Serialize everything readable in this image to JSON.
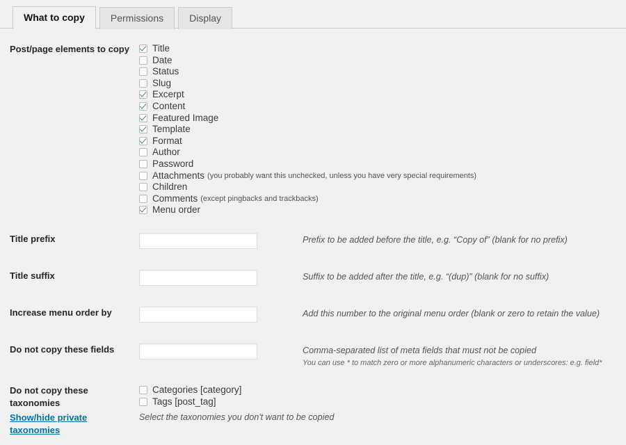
{
  "tabs": [
    {
      "label": "What to copy",
      "active": true
    },
    {
      "label": "Permissions",
      "active": false
    },
    {
      "label": "Display",
      "active": false
    }
  ],
  "elements_section": {
    "label": "Post/page elements to copy",
    "items": [
      {
        "label": "Title",
        "checked": true,
        "note": ""
      },
      {
        "label": "Date",
        "checked": false,
        "note": ""
      },
      {
        "label": "Status",
        "checked": false,
        "note": ""
      },
      {
        "label": "Slug",
        "checked": false,
        "note": ""
      },
      {
        "label": "Excerpt",
        "checked": true,
        "note": ""
      },
      {
        "label": "Content",
        "checked": true,
        "note": ""
      },
      {
        "label": "Featured Image",
        "checked": true,
        "note": ""
      },
      {
        "label": "Template",
        "checked": true,
        "note": ""
      },
      {
        "label": "Format",
        "checked": true,
        "note": ""
      },
      {
        "label": "Author",
        "checked": false,
        "note": ""
      },
      {
        "label": "Password",
        "checked": false,
        "note": ""
      },
      {
        "label": "Attachments",
        "checked": false,
        "note": "(you probably want this unchecked, unless you have very special requirements)"
      },
      {
        "label": "Children",
        "checked": false,
        "note": ""
      },
      {
        "label": "Comments",
        "checked": false,
        "note": "(except pingbacks and trackbacks)"
      },
      {
        "label": "Menu order",
        "checked": true,
        "note": ""
      }
    ]
  },
  "fields": [
    {
      "label": "Title prefix",
      "value": "",
      "placeholder": "",
      "desc": "Prefix to be added before the title, e.g. “Copy of” (blank for no prefix)",
      "desc2": ""
    },
    {
      "label": "Title suffix",
      "value": "",
      "placeholder": "",
      "desc": "Suffix to be added after the title, e.g. “(dup)” (blank for no suffix)",
      "desc2": ""
    },
    {
      "label": "Increase menu order by",
      "value": "",
      "placeholder": "",
      "desc": "Add this number to the original menu order (blank or zero to retain the value)",
      "desc2": ""
    },
    {
      "label": "Do not copy these fields",
      "value": "",
      "placeholder": "",
      "desc": "Comma-separated list of meta fields that must not be copied",
      "desc2": "You can use * to match zero or more alphanumeric characters or underscores: e.g. field*"
    }
  ],
  "taxonomies_section": {
    "label_line1": "Do not copy these",
    "label_line2": "taxonomies",
    "toggle_link": "Show/hide private taxonomies",
    "items": [
      {
        "label": "Categories [category]",
        "checked": false
      },
      {
        "label": "Tags [post_tag]",
        "checked": false
      }
    ],
    "desc": "Select the taxonomies you don't want to be copied"
  },
  "colors": {
    "page_background": "#f1f1f1",
    "tab_inactive_background": "#e5e5e5",
    "border": "#cccccc",
    "link": "#0073aa",
    "checkmark": "#3d7fa8",
    "label_text": "#23282d"
  }
}
